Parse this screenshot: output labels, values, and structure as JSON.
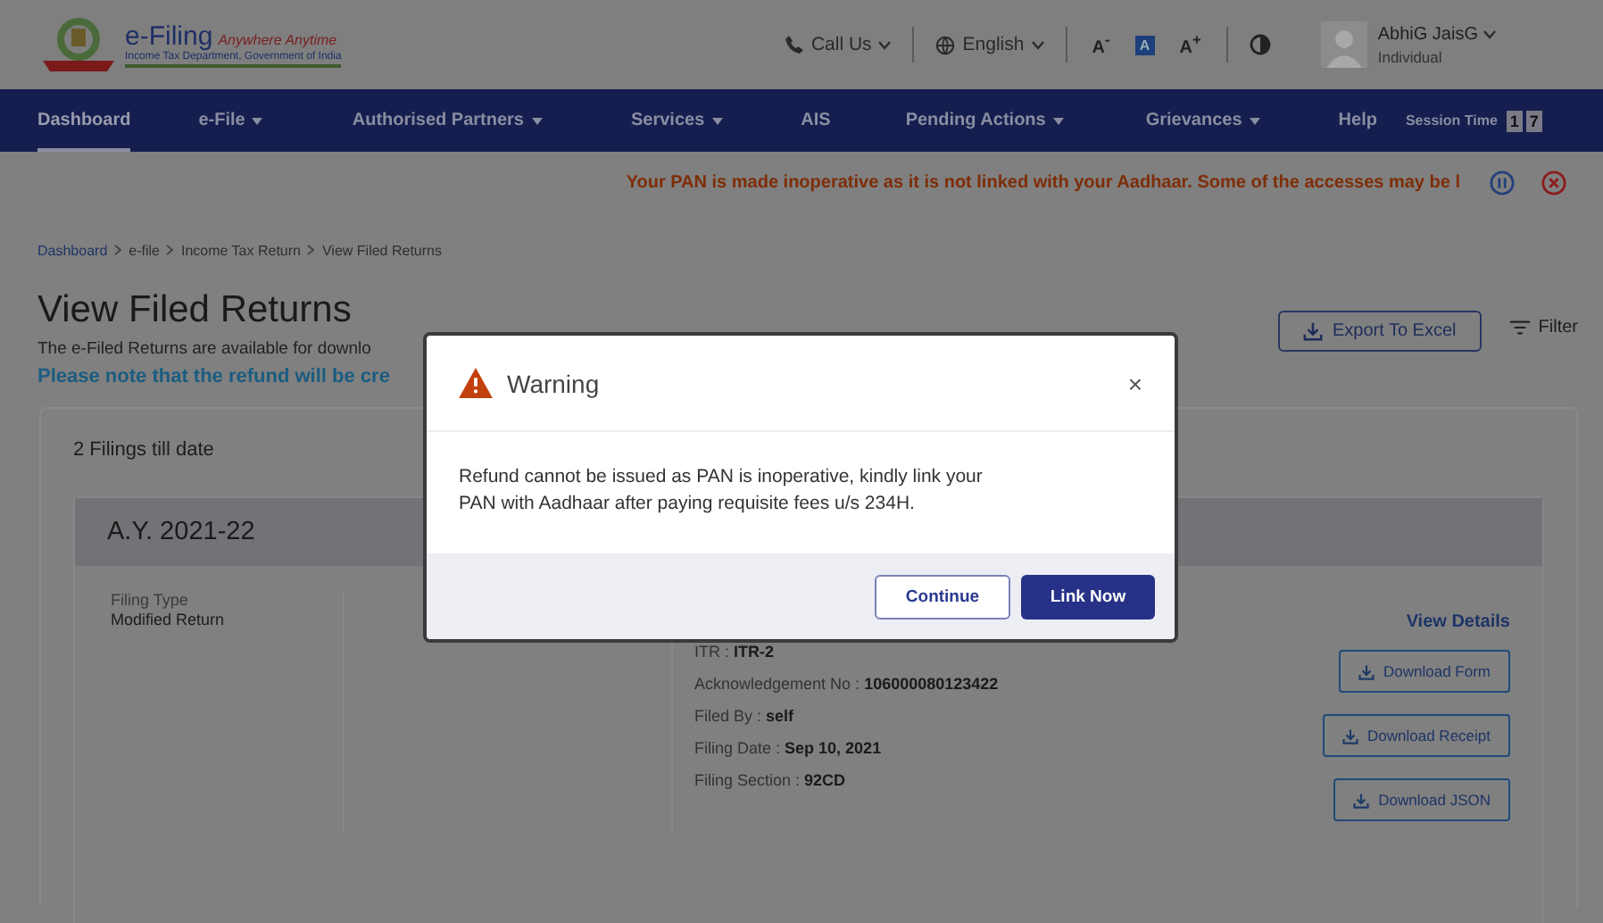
{
  "header": {
    "logo_title": "e-Filing",
    "logo_tagline": "Anywhere Anytime",
    "logo_subtitle": "Income Tax Department, Government of India",
    "call_us": "Call Us",
    "language": "English",
    "font_sizes": [
      {
        "label": "A$^{-}$",
        "selected": false
      },
      {
        "label": "A",
        "selected": true
      },
      {
        "label": "A$^{+}$",
        "selected": false
      }
    ],
    "user": {
      "name": "AbhiG JaisG",
      "role": "Individual"
    }
  },
  "nav": {
    "items": [
      {
        "label": "Dashboard",
        "has_menu": false,
        "selected": true
      },
      {
        "label": "e-File",
        "has_menu": true,
        "selected": false
      },
      {
        "label": "Authorised Partners",
        "has_menu": true,
        "selected": false
      },
      {
        "label": "Services",
        "has_menu": true,
        "selected": false
      },
      {
        "label": "AIS",
        "has_menu": false,
        "selected": false
      },
      {
        "label": "Pending Actions",
        "has_menu": true,
        "selected": false
      },
      {
        "label": "Grievances",
        "has_menu": true,
        "selected": false
      },
      {
        "label": "Help",
        "has_menu": false,
        "selected": false
      }
    ],
    "session_label": "Session Time",
    "session_digits": [
      "1",
      "7"
    ]
  },
  "banner": {
    "message": "Your PAN is made inoperative as it is not linked with your Aadhaar. Some of the accesses may be l"
  },
  "breadcrumb": [
    {
      "label": "Dashboard",
      "link": true
    },
    {
      "label": "e-file",
      "link": false
    },
    {
      "label": "Income Tax Return",
      "link": false
    },
    {
      "label": "View Filed Returns",
      "link": false
    }
  ],
  "page": {
    "title": "View Filed Returns",
    "intro": "The e-Filed Returns are available for downlo",
    "note": "Please note that the refund will be cre",
    "export_button": "Export To Excel",
    "filter_button": "Filter",
    "count": "2 Filings till date"
  },
  "filing": {
    "assessment_year": "A.Y. 2021-22",
    "filing_type_label": "Filing Type",
    "filing_type": "Modified Return",
    "details": [
      {
        "label": "ITR : ",
        "value": "ITR-2"
      },
      {
        "label": "Acknowledgement No : ",
        "value": "106000080123422"
      },
      {
        "label": "Filed By : ",
        "value": "self"
      },
      {
        "label": "Filing Date : ",
        "value": "Sep 10, 2021"
      },
      {
        "label": "Filing Section : ",
        "value": "92CD"
      }
    ],
    "view_details": "View Details",
    "downloads": [
      "Download Form",
      "Download Receipt",
      "Download JSON"
    ]
  },
  "modal": {
    "title": "Warning",
    "message": "Refund cannot be issued as PAN is inoperative, kindly link your PAN with Aadhaar after paying requisite fees u/s 234H.",
    "close": "×",
    "buttons": [
      {
        "label": "Continue",
        "primary": false
      },
      {
        "label": "Link Now",
        "primary": true
      }
    ]
  }
}
